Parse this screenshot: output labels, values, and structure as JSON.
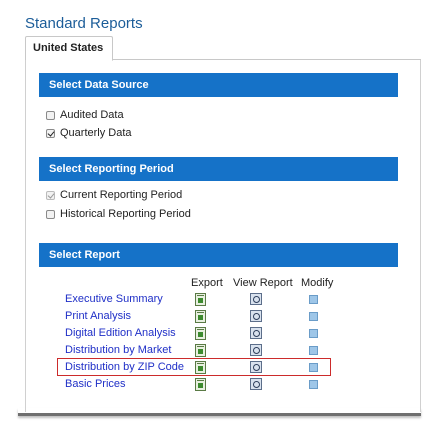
{
  "page": {
    "title": "Standard Reports"
  },
  "tabs": [
    {
      "label": "United States",
      "selected": true
    }
  ],
  "data_source": {
    "header": "Select Data Source",
    "options": [
      {
        "label": "Audited Data",
        "checked": false
      },
      {
        "label": "Quarterly Data",
        "checked": true
      }
    ]
  },
  "reporting_period": {
    "header": "Select Reporting Period",
    "options": [
      {
        "label": "Current Reporting Period",
        "checked": true,
        "disabled": true
      },
      {
        "label": "Historical Reporting Period",
        "checked": false
      }
    ]
  },
  "report": {
    "header": "Select Report",
    "columns": {
      "export": "Export",
      "view": "View Report",
      "modify": "Modify"
    },
    "items": [
      {
        "label": "Executive Summary"
      },
      {
        "label": "Print Analysis"
      },
      {
        "label": "Digital Edition Analysis"
      },
      {
        "label": "Distribution by Market"
      },
      {
        "label": "Distribution by ZIP Code",
        "highlighted": true
      },
      {
        "label": "Basic Prices"
      }
    ],
    "icons": {
      "export": "spreadsheet-export-icon",
      "view": "view-report-icon",
      "modify": "modify-icon"
    }
  },
  "colors": {
    "section_header": "#1572c8",
    "link": "#1f2fc7",
    "title": "#1c5d99",
    "highlight_border": "#cc2b2b"
  }
}
